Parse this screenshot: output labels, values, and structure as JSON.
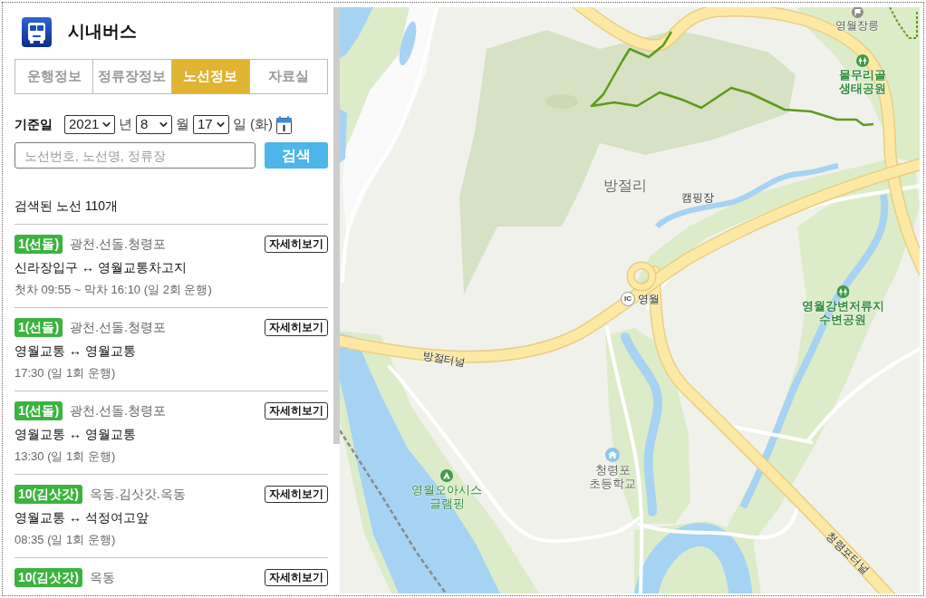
{
  "header": {
    "title": "시내버스"
  },
  "tabs": [
    {
      "label": "운행정보",
      "selected": false
    },
    {
      "label": "정류장정보",
      "selected": false
    },
    {
      "label": "노선정보",
      "selected": true
    },
    {
      "label": "자료실",
      "selected": false
    }
  ],
  "date_filter": {
    "label": "기준일",
    "selects": [
      {
        "value": "2021",
        "unit": "년"
      },
      {
        "value": "8",
        "unit": "월"
      },
      {
        "value": "17",
        "unit": "일"
      }
    ],
    "weekday": "(화)"
  },
  "search": {
    "placeholder": "노선번호, 노선명, 정류장",
    "button": "검색"
  },
  "result_count": "검색된 노선 110개",
  "routes": [
    {
      "badge": "1(선돌)",
      "via": "광천.선돌.청령포",
      "detail_button": "자세히보기",
      "endpoints": "신라장입구 ↔ 영월교통차고지",
      "schedule": "첫차 09:55 ~ 막차 16:10 (일 2회 운행)"
    },
    {
      "badge": "1(선돌)",
      "via": "광천.선돌.청령포",
      "detail_button": "자세히보기",
      "endpoints": "영월교통 ↔ 영월교통",
      "schedule": "17:30 (일 1회 운행)"
    },
    {
      "badge": "1(선돌)",
      "via": "광천.선돌.청령포",
      "detail_button": "자세히보기",
      "endpoints": "영월교통 ↔ 영월교통",
      "schedule": "13:30 (일 1회 운행)"
    },
    {
      "badge": "10(김삿갓)",
      "via": "옥동.김삿갓.옥동",
      "detail_button": "자세히보기",
      "endpoints": "영월교통 ↔ 석정여고앞",
      "schedule": "08:35 (일 1회 운행)"
    },
    {
      "badge": "10(김삿갓)",
      "via": "옥동",
      "detail_button": "자세히보기"
    }
  ],
  "map": {
    "labels": [
      {
        "kind": "landmark",
        "lines": [
          "영월장릉"
        ]
      },
      {
        "kind": "park",
        "lines": [
          "물무리골",
          "생태공원"
        ]
      },
      {
        "kind": "area",
        "lines": [
          "방절리"
        ]
      },
      {
        "kind": "facility",
        "lines": [
          "캠핑장"
        ]
      },
      {
        "kind": "interchange",
        "badge": "IC",
        "lines": [
          "영월"
        ]
      },
      {
        "kind": "park",
        "lines": [
          "영월강변저류지",
          "수변공원"
        ]
      },
      {
        "kind": "road",
        "lines": [
          "방절터널"
        ]
      },
      {
        "kind": "school",
        "lines": [
          "청령포",
          "초등학교"
        ]
      },
      {
        "kind": "camping",
        "lines": [
          "영월오아시스",
          "글램핑"
        ]
      },
      {
        "kind": "road",
        "lines": [
          "청령포터널"
        ]
      }
    ]
  }
}
